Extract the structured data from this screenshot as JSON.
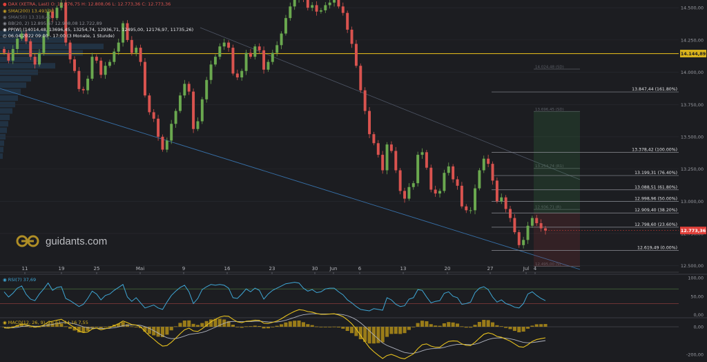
{
  "header": {
    "instrument_line": "DAX (XETRA, Last)  O: 12.776,75  H: 12.808,06  L: 12.773,36  C: 12.773,36",
    "sma200": "SMA(200)  13.493,90",
    "sma50": "SMA(50)  13.318,42",
    "bb": "BB(20, 2)  12.895,67  12.908,08  12.722,89",
    "ppw": "PP(W)  (14014,48, 13696,45, 13254,74, 12936,71, 12495,00, 12176,97, 11735,26)",
    "range": "06.04.2022 09:00 - 17:00  (3 Monate, 1 Stunde)"
  },
  "watermark": "guidants.com",
  "colors": {
    "background": "#1c1d21",
    "up": "#6aa84f",
    "down": "#d9534f",
    "yellow_line": "#d8b21c",
    "price_tag": "#e0403a",
    "trend": "#3a7ab8",
    "rsi": "#3fa7d6",
    "macd_line": "#e8c21e",
    "signal_line": "#b0b4c0"
  },
  "chart_data": [
    {
      "type": "candlestick",
      "title": "DAX (XETRA, Last)",
      "x_ticks": [
        "11",
        "19",
        "25",
        "Mai",
        "9",
        "16",
        "23",
        "30",
        "Jun",
        "6",
        "13",
        "20",
        "27",
        "Jul",
        "4"
      ],
      "y_ticks": [
        "14.500,00",
        "14.250,00",
        "14.000,00",
        "13.750,00",
        "13.500,00",
        "13.250,00",
        "13.000,00",
        "12.750,00",
        "12.500,00"
      ],
      "ylim": [
        12450,
        14560
      ],
      "horizontal_line": {
        "value": 14144.89,
        "label": "14.144,89"
      },
      "last_price": {
        "value": 12773.36,
        "label": "12.773,36"
      },
      "fibonacci": [
        {
          "value": 13847.44,
          "label": "13.847,44 (161.80%)"
        },
        {
          "value": 13378.42,
          "label": "13.378,42 (100.00%)"
        },
        {
          "value": 13199.31,
          "label": "13.199,31 (76.40%)"
        },
        {
          "value": 13088.51,
          "label": "13.088,51 (61.80%)"
        },
        {
          "value": 12998.96,
          "label": "12.998,96 (50.00%)"
        },
        {
          "value": 12909.4,
          "label": "12.909,40 (38.20%)"
        },
        {
          "value": 12798.6,
          "label": "12.798,60 (23.60%)"
        },
        {
          "value": 12619.49,
          "label": "12.619,49 (0.00%)"
        }
      ],
      "faint_levels": [
        {
          "value": 14024.48,
          "label": "14.024,48 (SD)"
        },
        {
          "value": 13696.45,
          "label": "13.696,45 (SD)"
        },
        {
          "value": 13254.74,
          "label": "13.254,74 (R1)"
        },
        {
          "value": 12936.71,
          "label": "12.936,71 (R)"
        },
        {
          "value": 12495.0,
          "label": "12.495,00 (S)"
        }
      ],
      "closes": [
        14150,
        14090,
        14180,
        14260,
        14300,
        14240,
        14120,
        14060,
        14150,
        14280,
        14470,
        14420,
        14500,
        14540,
        14230,
        14100,
        14010,
        13870,
        13860,
        13950,
        14120,
        14090,
        13980,
        14050,
        14080,
        14160,
        14230,
        14380,
        14250,
        14150,
        14190,
        14080,
        13820,
        13690,
        13640,
        13500,
        13400,
        13470,
        13600,
        13700,
        13820,
        13910,
        13850,
        13560,
        13620,
        13790,
        13940,
        14060,
        14120,
        14200,
        14230,
        14190,
        13990,
        13960,
        14010,
        14150,
        14120,
        14200,
        14170,
        14020,
        14080,
        14150,
        14210,
        14300,
        14420,
        14510,
        14570,
        14620,
        14560,
        14500,
        14520,
        14470,
        14480,
        14520,
        14540,
        14560,
        14510,
        14460,
        14330,
        14220,
        14050,
        13860,
        13700,
        13520,
        13450,
        13360,
        13240,
        13440,
        13390,
        13240,
        13080,
        13020,
        13110,
        13140,
        13360,
        13380,
        13260,
        13090,
        13060,
        13080,
        13220,
        13270,
        13170,
        13120,
        12960,
        12930,
        12930,
        13100,
        13240,
        13330,
        13290,
        13160,
        13000,
        13030,
        12940,
        12870,
        12760,
        12660,
        12700,
        12810,
        12870,
        12830,
        12790,
        12773
      ]
    },
    {
      "type": "line",
      "title": "RSI(7)",
      "legend": "RSI(7)  37,69",
      "y_ticks": [
        "100,00",
        "50,00",
        "0,00"
      ],
      "ylim": [
        -5,
        108
      ],
      "levels": [
        70,
        30
      ],
      "values": [
        62,
        48,
        58,
        72,
        78,
        55,
        42,
        38,
        56,
        70,
        86,
        66,
        74,
        76,
        44,
        38,
        30,
        22,
        28,
        44,
        64,
        56,
        40,
        52,
        56,
        66,
        74,
        82,
        48,
        36,
        46,
        32,
        18,
        22,
        26,
        18,
        14,
        34,
        52,
        64,
        74,
        80,
        62,
        30,
        44,
        68,
        76,
        82,
        80,
        82,
        80,
        72,
        46,
        44,
        56,
        70,
        62,
        72,
        66,
        42,
        56,
        66,
        72,
        78,
        84,
        86,
        88,
        86,
        72,
        64,
        68,
        60,
        62,
        70,
        72,
        72,
        62,
        54,
        40,
        32,
        22,
        14,
        12,
        10,
        16,
        14,
        12,
        46,
        40,
        28,
        22,
        24,
        42,
        46,
        68,
        66,
        48,
        32,
        36,
        38,
        58,
        62,
        50,
        46,
        28,
        30,
        34,
        60,
        72,
        76,
        68,
        48,
        34,
        40,
        30,
        26,
        20,
        18,
        30,
        56,
        62,
        52,
        44,
        38
      ]
    },
    {
      "type": "line",
      "title": "MACD(12, 26, 9)",
      "legend": "MACD(12, 26, 9)  -26,61  -34,16  7,55",
      "y_ticks": [
        "0,00",
        "-200,00"
      ],
      "ylim": [
        -245,
        60
      ],
      "macd": [
        -8,
        -10,
        -4,
        8,
        20,
        16,
        6,
        -2,
        2,
        12,
        34,
        40,
        48,
        54,
        34,
        14,
        -6,
        -30,
        -42,
        -38,
        -16,
        -10,
        -22,
        -14,
        -6,
        8,
        22,
        42,
        30,
        16,
        12,
        0,
        -34,
        -64,
        -90,
        -118,
        -140,
        -136,
        -112,
        -82,
        -50,
        -22,
        -10,
        -30,
        -34,
        -14,
        10,
        36,
        54,
        70,
        78,
        76,
        54,
        36,
        30,
        40,
        42,
        48,
        46,
        26,
        24,
        32,
        42,
        58,
        78,
        96,
        112,
        124,
        120,
        110,
        106,
        96,
        90,
        90,
        92,
        94,
        86,
        74,
        50,
        22,
        -16,
        -62,
        -108,
        -150,
        -180,
        -206,
        -230,
        -208,
        -200,
        -212,
        -226,
        -232,
        -214,
        -196,
        -158,
        -130,
        -124,
        -140,
        -148,
        -148,
        -124,
        -106,
        -102,
        -104,
        -124,
        -134,
        -136,
        -112,
        -82,
        -54,
        -44,
        -52,
        -70,
        -76,
        -90,
        -104,
        -124,
        -144,
        -148,
        -130,
        -106,
        -92,
        -86,
        -80
      ],
      "signal": [
        -6,
        -8,
        -7,
        -4,
        2,
        6,
        6,
        4,
        4,
        6,
        12,
        18,
        24,
        30,
        31,
        28,
        21,
        11,
        0,
        -8,
        -10,
        -10,
        -12,
        -12,
        -11,
        -7,
        -1,
        8,
        12,
        13,
        13,
        10,
        1,
        -12,
        -28,
        -46,
        -65,
        -79,
        -86,
        -85,
        -78,
        -67,
        -56,
        -51,
        -47,
        -41,
        -31,
        -17,
        -3,
        12,
        25,
        35,
        39,
        38,
        37,
        37,
        38,
        40,
        41,
        38,
        35,
        34,
        35,
        40,
        47,
        57,
        68,
        79,
        87,
        91,
        94,
        94,
        93,
        93,
        93,
        93,
        91,
        88,
        80,
        68,
        51,
        28,
        1,
        -29,
        -59,
        -88,
        -117,
        -135,
        -148,
        -161,
        -174,
        -186,
        -191,
        -192,
        -185,
        -174,
        -164,
        -159,
        -157,
        -155,
        -149,
        -140,
        -133,
        -127,
        -127,
        -128,
        -130,
        -126,
        -117,
        -104,
        -92,
        -84,
        -81,
        -80,
        -82,
        -87,
        -94,
        -104,
        -113,
        -116,
        -114,
        -110,
        -105,
        -100
      ]
    }
  ]
}
